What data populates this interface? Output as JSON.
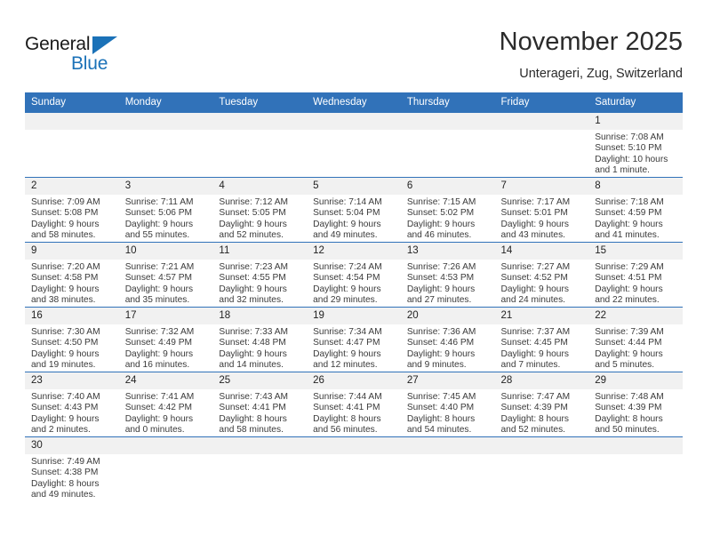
{
  "branding": {
    "logo_text_primary": "General",
    "logo_text_secondary": "Blue",
    "accent_color": "#1b72b8"
  },
  "header": {
    "title": "November 2025",
    "subtitle": "Unterageri, Zug, Switzerland"
  },
  "theme": {
    "header_row_bg": "#3172b9",
    "daynum_bg": "#f1f1f1",
    "grid_line": "#3172b9"
  },
  "calendar": {
    "weekday_headers": [
      "Sunday",
      "Monday",
      "Tuesday",
      "Wednesday",
      "Thursday",
      "Friday",
      "Saturday"
    ],
    "labels": {
      "sunrise_prefix": "Sunrise:",
      "sunset_prefix": "Sunset:",
      "daylight_prefix": "Daylight:"
    },
    "weeks": [
      [
        {
          "empty": true
        },
        {
          "empty": true
        },
        {
          "empty": true
        },
        {
          "empty": true
        },
        {
          "empty": true
        },
        {
          "empty": true
        },
        {
          "day": "1",
          "sunrise": "Sunrise: 7:08 AM",
          "sunset": "Sunset: 5:10 PM",
          "daylight": "Daylight: 10 hours and 1 minute."
        }
      ],
      [
        {
          "day": "2",
          "sunrise": "Sunrise: 7:09 AM",
          "sunset": "Sunset: 5:08 PM",
          "daylight": "Daylight: 9 hours and 58 minutes."
        },
        {
          "day": "3",
          "sunrise": "Sunrise: 7:11 AM",
          "sunset": "Sunset: 5:06 PM",
          "daylight": "Daylight: 9 hours and 55 minutes."
        },
        {
          "day": "4",
          "sunrise": "Sunrise: 7:12 AM",
          "sunset": "Sunset: 5:05 PM",
          "daylight": "Daylight: 9 hours and 52 minutes."
        },
        {
          "day": "5",
          "sunrise": "Sunrise: 7:14 AM",
          "sunset": "Sunset: 5:04 PM",
          "daylight": "Daylight: 9 hours and 49 minutes."
        },
        {
          "day": "6",
          "sunrise": "Sunrise: 7:15 AM",
          "sunset": "Sunset: 5:02 PM",
          "daylight": "Daylight: 9 hours and 46 minutes."
        },
        {
          "day": "7",
          "sunrise": "Sunrise: 7:17 AM",
          "sunset": "Sunset: 5:01 PM",
          "daylight": "Daylight: 9 hours and 43 minutes."
        },
        {
          "day": "8",
          "sunrise": "Sunrise: 7:18 AM",
          "sunset": "Sunset: 4:59 PM",
          "daylight": "Daylight: 9 hours and 41 minutes."
        }
      ],
      [
        {
          "day": "9",
          "sunrise": "Sunrise: 7:20 AM",
          "sunset": "Sunset: 4:58 PM",
          "daylight": "Daylight: 9 hours and 38 minutes."
        },
        {
          "day": "10",
          "sunrise": "Sunrise: 7:21 AM",
          "sunset": "Sunset: 4:57 PM",
          "daylight": "Daylight: 9 hours and 35 minutes."
        },
        {
          "day": "11",
          "sunrise": "Sunrise: 7:23 AM",
          "sunset": "Sunset: 4:55 PM",
          "daylight": "Daylight: 9 hours and 32 minutes."
        },
        {
          "day": "12",
          "sunrise": "Sunrise: 7:24 AM",
          "sunset": "Sunset: 4:54 PM",
          "daylight": "Daylight: 9 hours and 29 minutes."
        },
        {
          "day": "13",
          "sunrise": "Sunrise: 7:26 AM",
          "sunset": "Sunset: 4:53 PM",
          "daylight": "Daylight: 9 hours and 27 minutes."
        },
        {
          "day": "14",
          "sunrise": "Sunrise: 7:27 AM",
          "sunset": "Sunset: 4:52 PM",
          "daylight": "Daylight: 9 hours and 24 minutes."
        },
        {
          "day": "15",
          "sunrise": "Sunrise: 7:29 AM",
          "sunset": "Sunset: 4:51 PM",
          "daylight": "Daylight: 9 hours and 22 minutes."
        }
      ],
      [
        {
          "day": "16",
          "sunrise": "Sunrise: 7:30 AM",
          "sunset": "Sunset: 4:50 PM",
          "daylight": "Daylight: 9 hours and 19 minutes."
        },
        {
          "day": "17",
          "sunrise": "Sunrise: 7:32 AM",
          "sunset": "Sunset: 4:49 PM",
          "daylight": "Daylight: 9 hours and 16 minutes."
        },
        {
          "day": "18",
          "sunrise": "Sunrise: 7:33 AM",
          "sunset": "Sunset: 4:48 PM",
          "daylight": "Daylight: 9 hours and 14 minutes."
        },
        {
          "day": "19",
          "sunrise": "Sunrise: 7:34 AM",
          "sunset": "Sunset: 4:47 PM",
          "daylight": "Daylight: 9 hours and 12 minutes."
        },
        {
          "day": "20",
          "sunrise": "Sunrise: 7:36 AM",
          "sunset": "Sunset: 4:46 PM",
          "daylight": "Daylight: 9 hours and 9 minutes."
        },
        {
          "day": "21",
          "sunrise": "Sunrise: 7:37 AM",
          "sunset": "Sunset: 4:45 PM",
          "daylight": "Daylight: 9 hours and 7 minutes."
        },
        {
          "day": "22",
          "sunrise": "Sunrise: 7:39 AM",
          "sunset": "Sunset: 4:44 PM",
          "daylight": "Daylight: 9 hours and 5 minutes."
        }
      ],
      [
        {
          "day": "23",
          "sunrise": "Sunrise: 7:40 AM",
          "sunset": "Sunset: 4:43 PM",
          "daylight": "Daylight: 9 hours and 2 minutes."
        },
        {
          "day": "24",
          "sunrise": "Sunrise: 7:41 AM",
          "sunset": "Sunset: 4:42 PM",
          "daylight": "Daylight: 9 hours and 0 minutes."
        },
        {
          "day": "25",
          "sunrise": "Sunrise: 7:43 AM",
          "sunset": "Sunset: 4:41 PM",
          "daylight": "Daylight: 8 hours and 58 minutes."
        },
        {
          "day": "26",
          "sunrise": "Sunrise: 7:44 AM",
          "sunset": "Sunset: 4:41 PM",
          "daylight": "Daylight: 8 hours and 56 minutes."
        },
        {
          "day": "27",
          "sunrise": "Sunrise: 7:45 AM",
          "sunset": "Sunset: 4:40 PM",
          "daylight": "Daylight: 8 hours and 54 minutes."
        },
        {
          "day": "28",
          "sunrise": "Sunrise: 7:47 AM",
          "sunset": "Sunset: 4:39 PM",
          "daylight": "Daylight: 8 hours and 52 minutes."
        },
        {
          "day": "29",
          "sunrise": "Sunrise: 7:48 AM",
          "sunset": "Sunset: 4:39 PM",
          "daylight": "Daylight: 8 hours and 50 minutes."
        }
      ],
      [
        {
          "day": "30",
          "sunrise": "Sunrise: 7:49 AM",
          "sunset": "Sunset: 4:38 PM",
          "daylight": "Daylight: 8 hours and 49 minutes."
        },
        {
          "empty": true
        },
        {
          "empty": true
        },
        {
          "empty": true
        },
        {
          "empty": true
        },
        {
          "empty": true
        },
        {
          "empty": true
        }
      ]
    ]
  }
}
